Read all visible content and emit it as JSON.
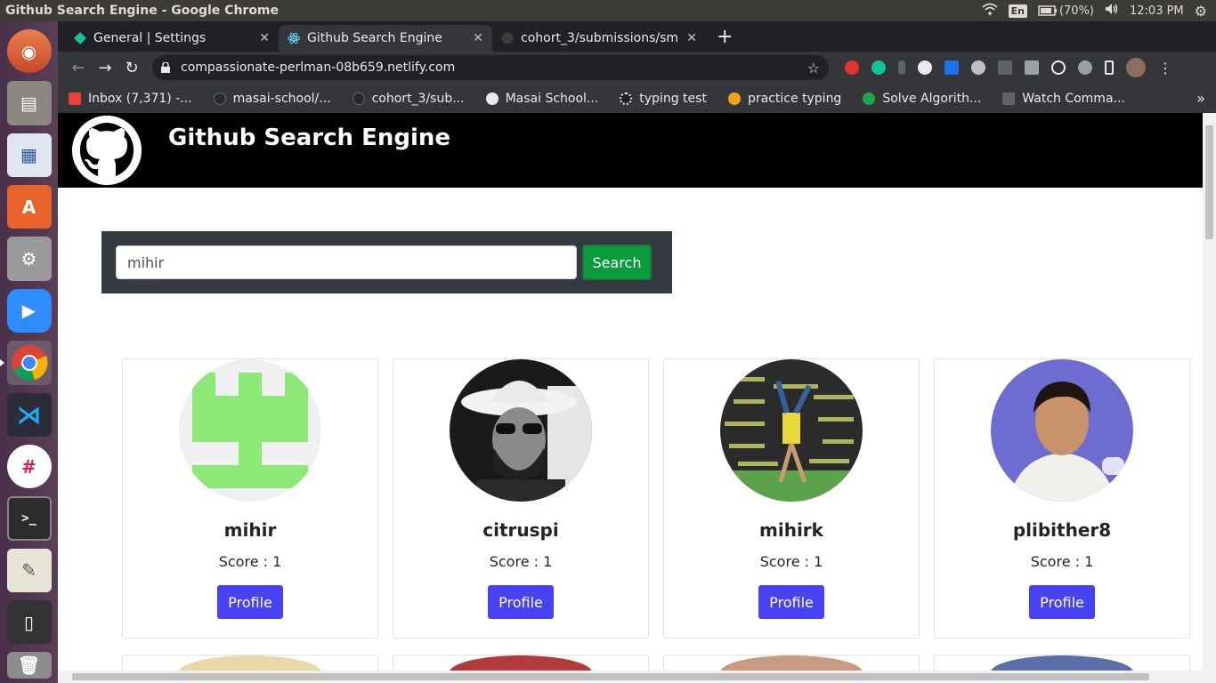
{
  "os": {
    "window_title": "Github Search Engine - Google Chrome",
    "lang": "En",
    "battery": "(70%)",
    "time": "12:03 PM"
  },
  "browser": {
    "tabs": [
      {
        "label": "General | Settings",
        "icon": "settings-favicon"
      },
      {
        "label": "Github Search Engine",
        "icon": "react-favicon"
      },
      {
        "label": "cohort_3/submissions/sm",
        "icon": "github-favicon"
      }
    ],
    "url": "compassionate-perlman-08b659.netlify.com",
    "bookmarks": [
      {
        "label": "Inbox (7,371) -...",
        "icon": "gmail-icon",
        "color": "#ea4335"
      },
      {
        "label": "masai-school/...",
        "icon": "github-icon",
        "color": "#24292e"
      },
      {
        "label": "cohort_3/sub...",
        "icon": "github-icon",
        "color": "#24292e"
      },
      {
        "label": "Masai School...",
        "icon": "globe-icon",
        "color": "#e8eaed"
      },
      {
        "label": "typing test",
        "icon": "paw-icon",
        "color": "#202124"
      },
      {
        "label": "practice typing",
        "icon": "bolt-icon",
        "color": "#f7a21b"
      },
      {
        "label": "Solve Algorith...",
        "icon": "hackerrank-icon",
        "color": "#1ba94c"
      },
      {
        "label": "Watch Comma...",
        "icon": "tr-icon",
        "color": "#5f6368"
      }
    ]
  },
  "site": {
    "title": "Github Search Engine",
    "search": {
      "value": "mihir",
      "button": "Search"
    },
    "results": [
      {
        "login": "mihir",
        "score": "Score : 1",
        "button": "Profile",
        "avatar": "identicon"
      },
      {
        "login": "citruspi",
        "score": "Score : 1",
        "button": "Profile",
        "avatar": "cowboy-photo"
      },
      {
        "login": "mihirk",
        "score": "Score : 1",
        "button": "Profile",
        "avatar": "handstand-photo"
      },
      {
        "login": "plibither8",
        "score": "Score : 1",
        "button": "Profile",
        "avatar": "portrait-photo"
      }
    ]
  },
  "colors": {
    "header_bg": "#000000",
    "search_panel": "#343a40",
    "search_button": "#0a9b3c",
    "profile_button": "#4743f5"
  }
}
